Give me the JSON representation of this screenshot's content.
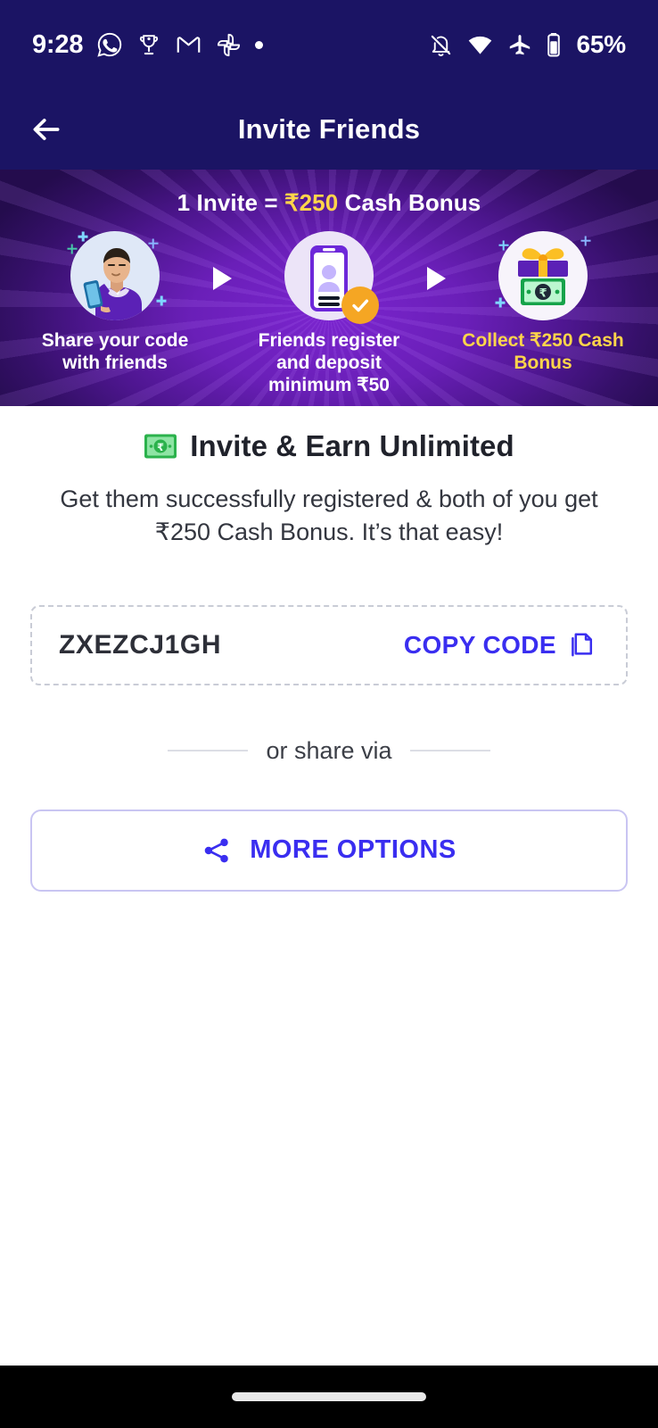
{
  "status_bar": {
    "time": "9:28",
    "battery_percent": "65%",
    "left_icons": [
      "whatsapp-icon",
      "trophy-icon",
      "gmail-icon",
      "google-photos-icon",
      "notification-dot-icon"
    ],
    "right_icons": [
      "mute-bell-icon",
      "wifi-icon",
      "airplane-mode-icon",
      "battery-icon"
    ]
  },
  "app_bar": {
    "title": "Invite Friends",
    "back_icon": "back-arrow-icon"
  },
  "banner": {
    "headline_prefix": "1 Invite = ",
    "headline_amount": "₹250",
    "headline_suffix": " Cash Bonus",
    "steps": [
      {
        "label": "Share your code with friends",
        "art": "person-with-phone-icon",
        "highlight": false
      },
      {
        "label": "Friends register and deposit minimum ₹50",
        "art": "phone-id-card-check-icon",
        "highlight": false
      },
      {
        "label": "Collect ₹250 Cash Bonus",
        "art": "gift-with-cash-icon",
        "highlight": true
      }
    ],
    "separator_icon": "triangle-arrow-right-icon",
    "gold_color": "#ffd54a"
  },
  "main": {
    "title_emoji": "banknote-rupee-icon",
    "title": "Invite & Earn Unlimited",
    "subtitle": "Get them successfully registered & both of you get ₹250 Cash Bonus. It’s that easy!",
    "referral_code": "ZXEZCJ1GH",
    "copy_label": "COPY CODE",
    "copy_icon": "copy-icon",
    "divider_text": "or share via",
    "more_options_label": "MORE OPTIONS",
    "share_icon": "share-nodes-icon",
    "accent_color": "#3a2ef0"
  },
  "nav_bar": {
    "gesture_pill": "home-gesture-pill"
  }
}
